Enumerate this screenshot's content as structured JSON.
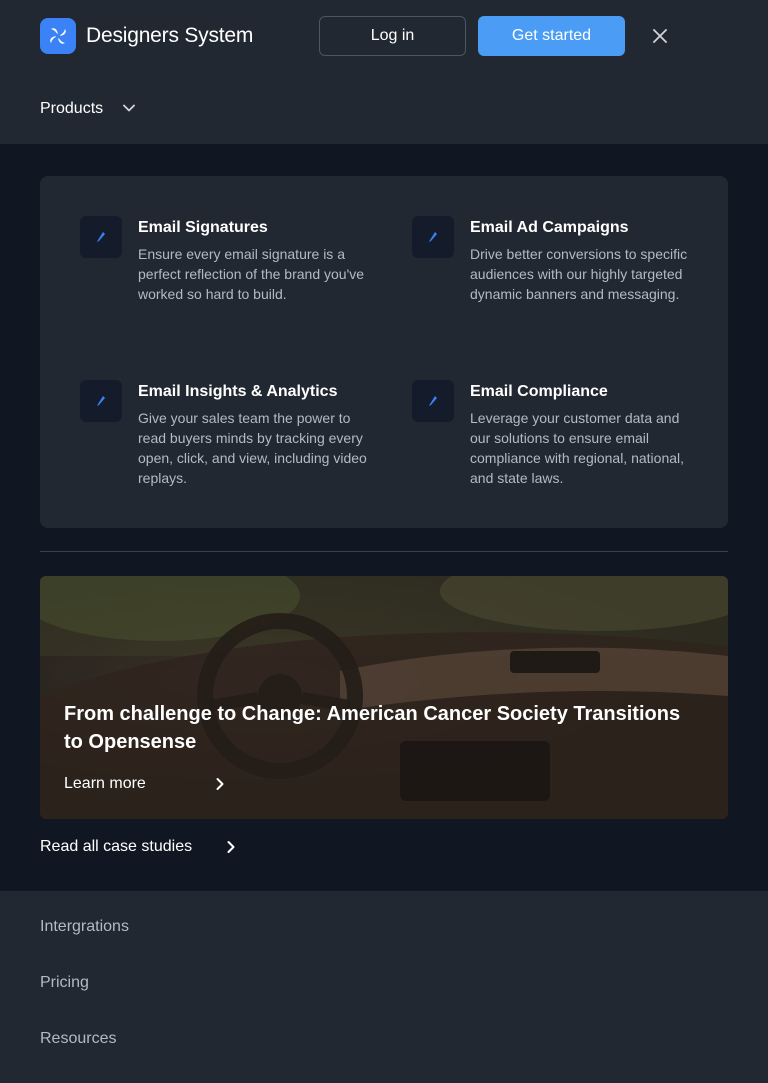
{
  "header": {
    "brand": "Designers System",
    "login_label": "Log in",
    "get_started_label": "Get started"
  },
  "nav": {
    "products_label": "Products"
  },
  "features": [
    {
      "title": "Email Signatures",
      "description": "Ensure every email signature is a perfect reflection of the brand you've worked so hard to build."
    },
    {
      "title": "Email Ad Campaigns",
      "description": "Drive better conversions to specific audiences with our highly targeted dynamic banners and messaging."
    },
    {
      "title": "Email Insights & Analytics",
      "description": "Give your sales team the power to read buyers minds by tracking every open, click, and view, including video replays."
    },
    {
      "title": "Email Compliance",
      "description": "Leverage your customer data and our solutions to ensure email compliance with regional, national, and state laws."
    }
  ],
  "case_study": {
    "title": "From challenge to Change: American Cancer Society Transitions to Opensense",
    "link_label": "Learn more"
  },
  "read_all_label": "Read all case studies",
  "bottom_nav": [
    {
      "label": "Intergrations"
    },
    {
      "label": "Pricing"
    },
    {
      "label": "Resources"
    }
  ],
  "colors": {
    "accent": "#4a9cf5",
    "background": "#222831",
    "panel": "#111722"
  }
}
